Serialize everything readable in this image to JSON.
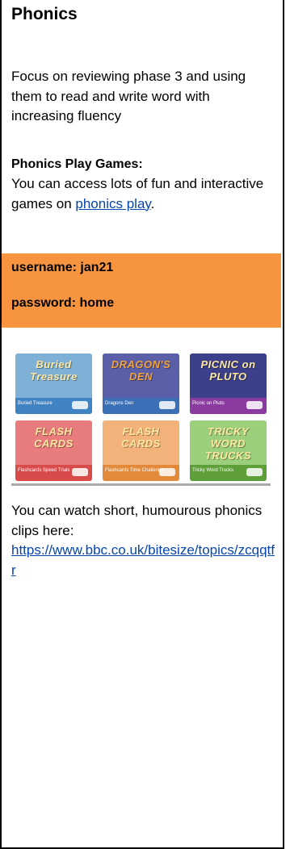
{
  "heading": "Phonics",
  "intro": "Focus on reviewing phase 3 and using them to read and write word with increasing fluency",
  "games_heading": "Phonics Play Games:",
  "games_text_before": "You can access lots of fun and interactive games on ",
  "games_link": "phonics play",
  "games_text_after": ".",
  "username": "username: jan21",
  "password": "password: home",
  "colors": {
    "highlight": "#f7943f",
    "link": "#0645ad"
  },
  "games": [
    {
      "title": "Buried Treasure",
      "caption": "Buried Treasure",
      "art": "#7fb0d6",
      "cap": "#3f83c3"
    },
    {
      "title": "DRAGON'S DEN",
      "caption": "Dragons Den",
      "art": "#5b5fa8",
      "cap": "#3b6fb6"
    },
    {
      "title": "PICNIC on PLUTO",
      "caption": "Picnic on Pluto",
      "art": "#3c3f8a",
      "cap": "#8b3aa0"
    },
    {
      "title": "FLASH CARDS",
      "caption": "Flashcards Speed Trials",
      "art": "#e87b7b",
      "cap": "#d94a4a"
    },
    {
      "title": "FLASH CARDS",
      "caption": "Flashcards Time Challenge",
      "art": "#f2b27a",
      "cap": "#e28a3a"
    },
    {
      "title": "TRICKY WORD TRUCKS",
      "caption": "Tricky Word Trucks",
      "art": "#9ccf7b",
      "cap": "#5f9f3a"
    }
  ],
  "clips_text": "You can watch short, humourous phonics clips here:",
  "clips_link": "https://www.bbc.co.uk/bitesize/topics/zcqqtfr"
}
